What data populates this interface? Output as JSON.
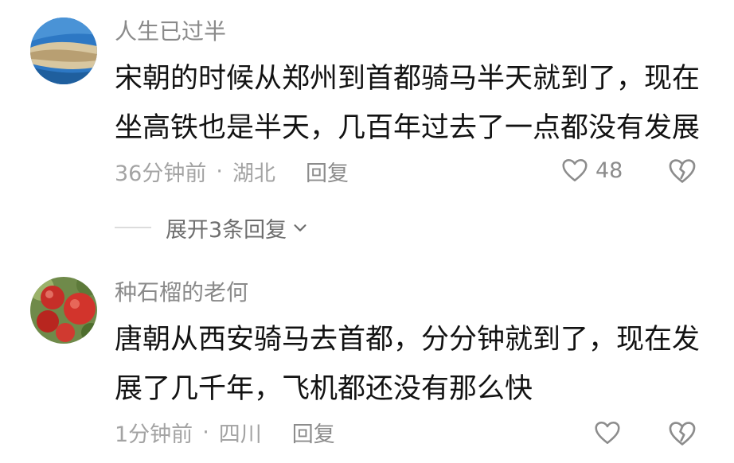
{
  "comments": [
    {
      "username": "人生已过半",
      "text": "宋朝的时候从郑州到首都骑马半天就到了，现在坐高铁也是半天，几百年过去了一点都没有发展",
      "time": "36分钟前",
      "separator": "·",
      "location": "湖北",
      "reply_label": "回复",
      "likes": "48",
      "expand_label": "展开3条回复"
    },
    {
      "username": "种石榴的老何",
      "text": "唐朝从西安骑马去首都，分分钟就到了，现在发展了几千年，飞机都还没有那么快",
      "time": "1分钟前",
      "separator": "·",
      "location": "四川",
      "reply_label": "回复"
    }
  ],
  "icons": {
    "like": "heart-outline-icon",
    "dislike": "broken-heart-icon",
    "expand": "chevron-down-icon"
  },
  "colors": {
    "text": "#121212",
    "username": "#8a8a8a",
    "meta": "#a3a3a3",
    "icon": "#8c8c8c"
  }
}
